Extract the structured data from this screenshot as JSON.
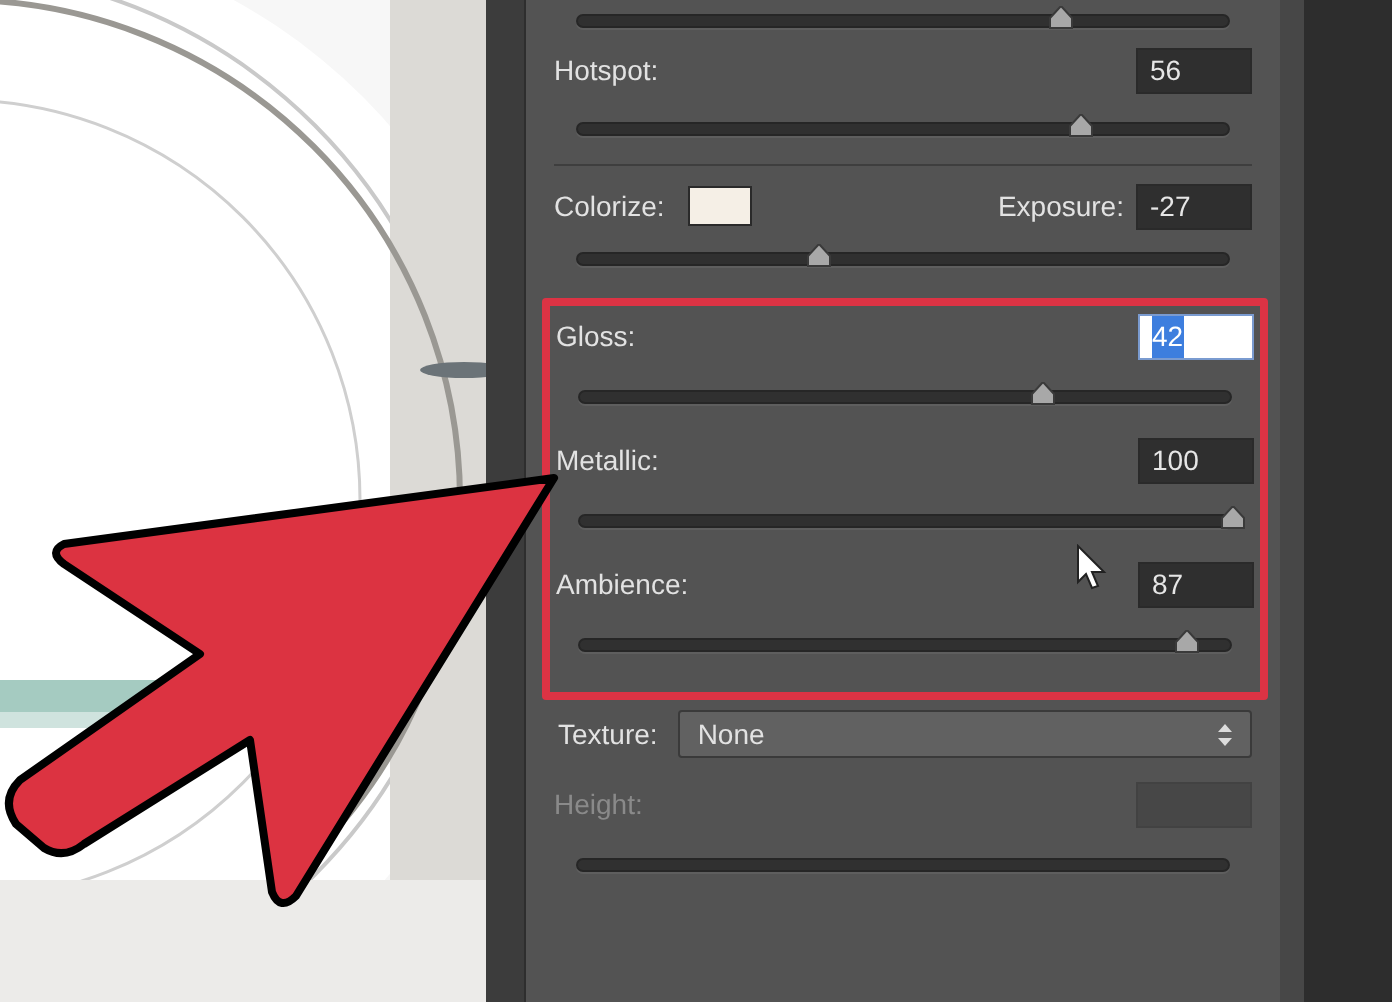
{
  "top_slider": {
    "level": 0.74
  },
  "hotspot": {
    "label": "Hotspot:",
    "value": "56",
    "level": 0.77
  },
  "colorize": {
    "label": "Colorize:",
    "color": "#f5efe6"
  },
  "exposure": {
    "label": "Exposure:",
    "value": "-27",
    "level": 0.37
  },
  "highlighted": [
    {
      "label": "Gloss:",
      "value": "42",
      "selected": true,
      "level": 0.71
    },
    {
      "label": "Metallic:",
      "value": "100",
      "selected": false,
      "level": 1
    },
    {
      "label": "Ambience:",
      "value": "87",
      "selected": false,
      "level": 0.93
    }
  ],
  "texture": {
    "label": "Texture:",
    "value": "None"
  },
  "height": {
    "label": "Height:",
    "disabled": true
  }
}
